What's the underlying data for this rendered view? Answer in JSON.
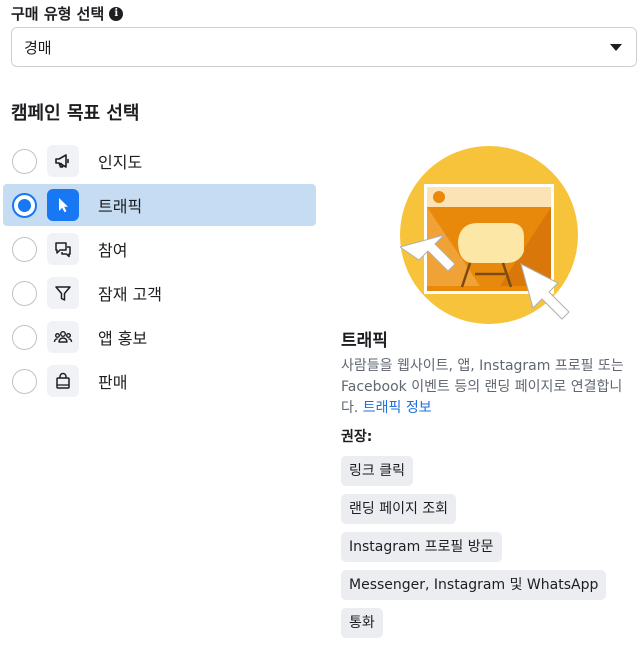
{
  "buy_type": {
    "label": "구매 유형 선택",
    "info_icon": "info-icon",
    "selected": "경매"
  },
  "goal": {
    "title": "캠페인 목표 선택",
    "options": [
      {
        "label": "인지도",
        "icon": "megaphone-icon",
        "selected": false
      },
      {
        "label": "트래픽",
        "icon": "cursor-icon",
        "selected": true
      },
      {
        "label": "참여",
        "icon": "chat-bubbles-icon",
        "selected": false
      },
      {
        "label": "잠재 고객",
        "icon": "funnel-icon",
        "selected": false
      },
      {
        "label": "앱 홍보",
        "icon": "people-icon",
        "selected": false
      },
      {
        "label": "판매",
        "icon": "shopping-bag-icon",
        "selected": false
      }
    ]
  },
  "detail": {
    "title": "트래픽",
    "description": "사람들을 웹사이트, 앱, Instagram 프로필 또는 Facebook 이벤트 등의 랜딩 페이지로 연결합니다.",
    "link": "트래픽 정보",
    "recommended_label": "권장:",
    "recommended": [
      "링크 클릭",
      "랜딩 페이지 조회",
      "Instagram 프로필 방문",
      "Messenger, Instagram 및 WhatsApp",
      "통화"
    ]
  },
  "colors": {
    "accent": "#1877f2",
    "selected_row": "#c5dcf3",
    "illustration_yellow": "#f7c33a",
    "illustration_orange": "#e8890c"
  }
}
